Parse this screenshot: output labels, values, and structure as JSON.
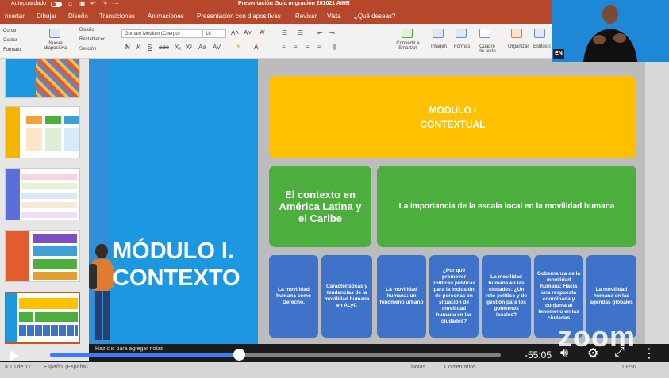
{
  "titlebar": {
    "autosave_label": "Autoguardado",
    "document_title": "Presentación Guía migración 261021 AIHR"
  },
  "ribbon_tabs": [
    "nsertar",
    "Dibujar",
    "Diseño",
    "Transiciones",
    "Animaciones",
    "Presentación con diapositivas",
    "Revisar",
    "Vista",
    "¿Qué deseas?"
  ],
  "ribbon": {
    "cortar": "Cortar",
    "copiar": "Copiar",
    "formato": "Formato",
    "nueva_diapositiva": "Nueva diapositiva",
    "diseno": "Diseño",
    "restablecer": "Restablecer",
    "seccion": "Sección",
    "font_name": "Gotham Medium (Cuerpo)",
    "font_size": "18",
    "convertir_smartart": "Convertir a SmartArt",
    "imagen": "Imagen",
    "formas": "Formas",
    "cuadro_texto": "Cuadro de texto",
    "organizar": "Organizar",
    "estilos_rapidos": "Estilos rápidos"
  },
  "slide": {
    "module_title": "MÓDULO I. CONTEXTO",
    "top_box": "MÓDULO I CONTEXTUAL",
    "green_left": "El contexto en América Latina y el Caribe",
    "green_right": "La importancia de la escala local en la movilidad humana",
    "blue_boxes": [
      "La movilidad humana como Derecho.",
      "Características y tendencias de la movilidad humana en ALyC",
      "La movilidad humana: un fenómeno urbano",
      "¿Por qué promover políticas públicas para la inclusión de personas en situación de movilidad humana en las ciudades?",
      "La movilidad humana en las ciudades: ¿Un reto político y de gestión para los gobiernos locales?",
      "Gobernanza de la movilidad humana: Hacia una respuesta coordinada y conjunta al fenómeno en las ciudades",
      "La movilidad humana en las agendas globales"
    ]
  },
  "notes_placeholder": "Haz clic para agregar notas",
  "player": {
    "remaining_time": "-55:05",
    "progress": 0.42,
    "logo": "zoom"
  },
  "statusbar": {
    "slide_counter": "a 10 de 17",
    "language": "Español (España)",
    "notas": "Notas",
    "comentarios": "Comentarios",
    "zoom": "132%"
  },
  "interpreter_badge": "EN",
  "colors": {
    "ribbon_red": "#b7472a",
    "slide_blue": "#1b98e0",
    "yellow": "#ffc000",
    "green": "#4caf3d",
    "box_blue": "#3f73c9"
  }
}
